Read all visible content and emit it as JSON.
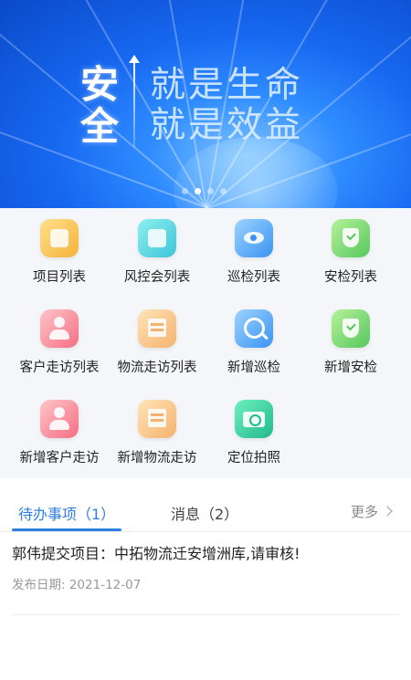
{
  "banner": {
    "slogan_big": [
      "安",
      "全"
    ],
    "slogan_small": [
      "就是生命",
      "就是效益"
    ],
    "dots_total": 4,
    "dots_active_index": 1
  },
  "menu": [
    {
      "label": "项目列表",
      "icon": "project-list-icon"
    },
    {
      "label": "风控会列表",
      "icon": "risk-meeting-icon"
    },
    {
      "label": "巡检列表",
      "icon": "patrol-list-icon"
    },
    {
      "label": "安检列表",
      "icon": "safety-check-list-icon"
    },
    {
      "label": "客户走访列表",
      "icon": "customer-visit-list-icon"
    },
    {
      "label": "物流走访列表",
      "icon": "logistics-visit-list-icon"
    },
    {
      "label": "新增巡检",
      "icon": "add-patrol-icon"
    },
    {
      "label": "新增安检",
      "icon": "add-safety-check-icon"
    },
    {
      "label": "新增客户走访",
      "icon": "add-customer-visit-icon"
    },
    {
      "label": "新增物流走访",
      "icon": "add-logistics-visit-icon"
    },
    {
      "label": "定位拍照",
      "icon": "location-photo-icon"
    }
  ],
  "tabs": {
    "todo_label": "待办事项（1）",
    "messages_label": "消息（2）",
    "more_label": "更多"
  },
  "todo_items": [
    {
      "title": "郭伟提交项目：中拓物流迁安增洲库,请审核!",
      "date": "发布日期: 2021-12-07"
    }
  ],
  "colors": {
    "accent": "#2f7fe0",
    "banner_blue": "#1768f0"
  }
}
